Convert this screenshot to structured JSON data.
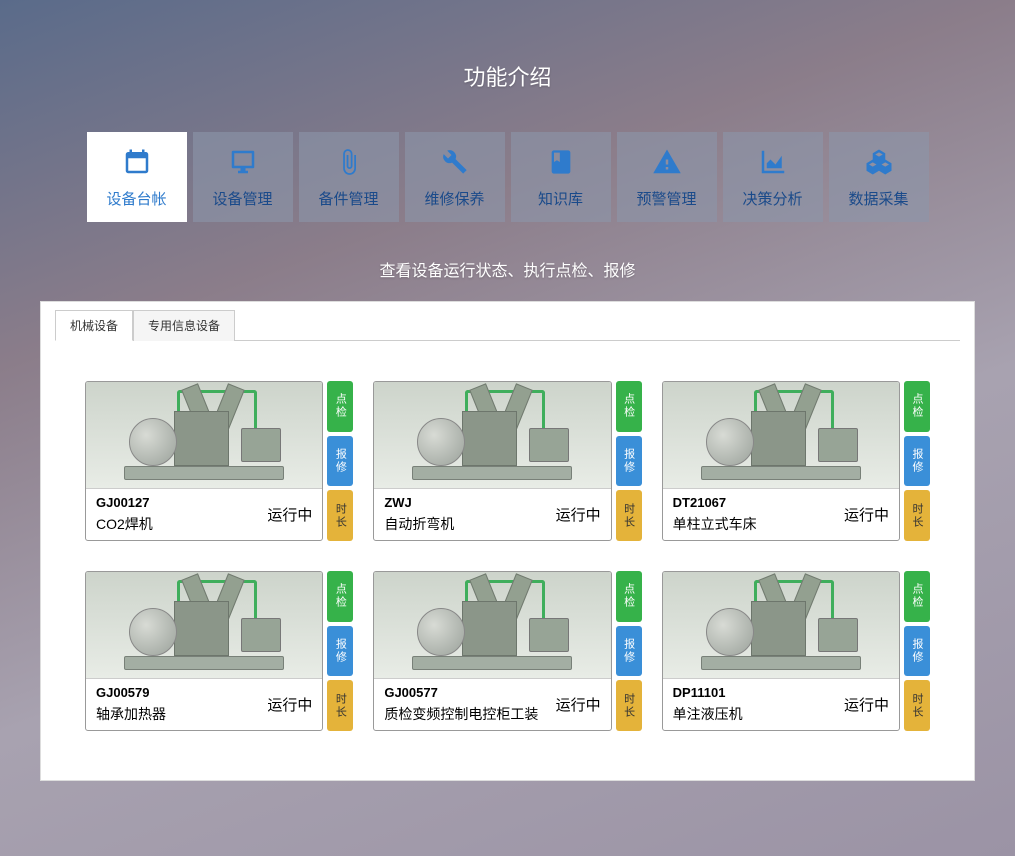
{
  "title": "功能介绍",
  "tabs": [
    {
      "label": "设备台帐"
    },
    {
      "label": "设备管理"
    },
    {
      "label": "备件管理"
    },
    {
      "label": "维修保养"
    },
    {
      "label": "知识库"
    },
    {
      "label": "预警管理"
    },
    {
      "label": "决策分析"
    },
    {
      "label": "数据采集"
    }
  ],
  "subtitle": "查看设备运行状态、执行点检、报修",
  "panel_tabs": [
    {
      "label": "机械设备"
    },
    {
      "label": "专用信息设备"
    }
  ],
  "card_buttons": {
    "inspect": "点检",
    "repair": "报修",
    "duration": "时长"
  },
  "cards": [
    {
      "code": "GJ00127",
      "name": "CO2焊机",
      "status": "运行中"
    },
    {
      "code": "ZWJ",
      "name": "自动折弯机",
      "status": "运行中"
    },
    {
      "code": "DT21067",
      "name": "单柱立式车床",
      "status": "运行中"
    },
    {
      "code": "GJ00579",
      "name": "轴承加热器",
      "status": "运行中"
    },
    {
      "code": "GJ00577",
      "name": "质检变频控制电控柜工装",
      "status": "运行中"
    },
    {
      "code": "DP11101",
      "name": "单注液压机",
      "status": "运行中"
    }
  ]
}
